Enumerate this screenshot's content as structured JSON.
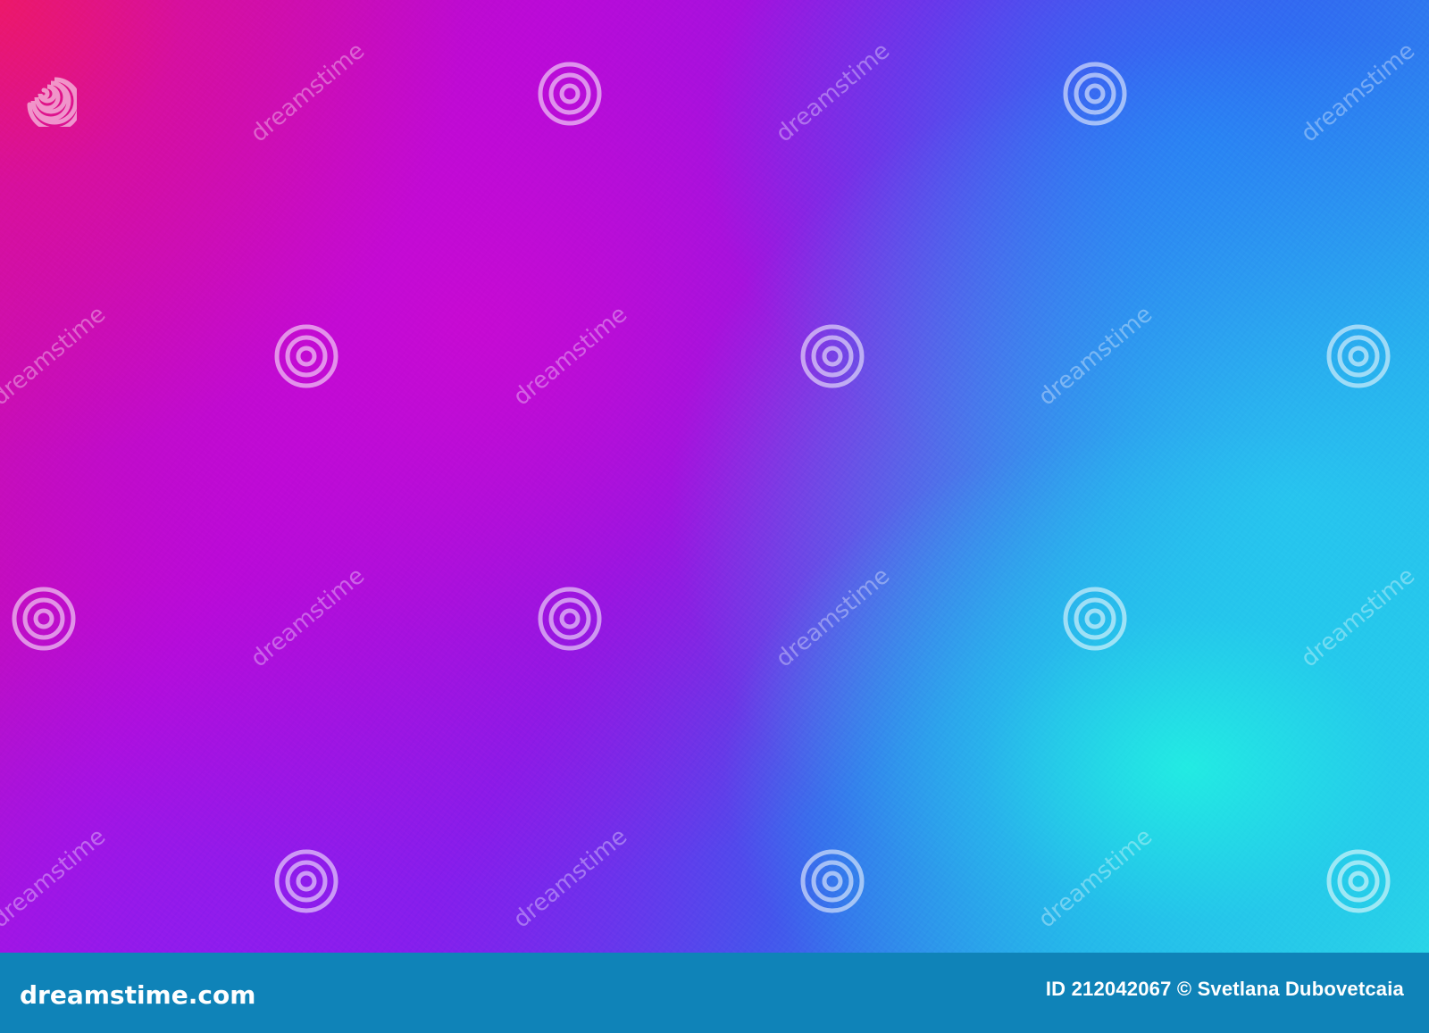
{
  "watermark": {
    "brand_text": "dreamstime",
    "site_text": "dreamstime.com",
    "image_id": "ID 212042067",
    "copyright": "©",
    "author": "Svetlana Dubovetcaia"
  },
  "colors": {
    "top_left": "#e8186e",
    "center": "#b80ad8",
    "top_right": "#2b78f0",
    "bottom_right": "#25e6e2",
    "footer": "#0f83b8"
  }
}
